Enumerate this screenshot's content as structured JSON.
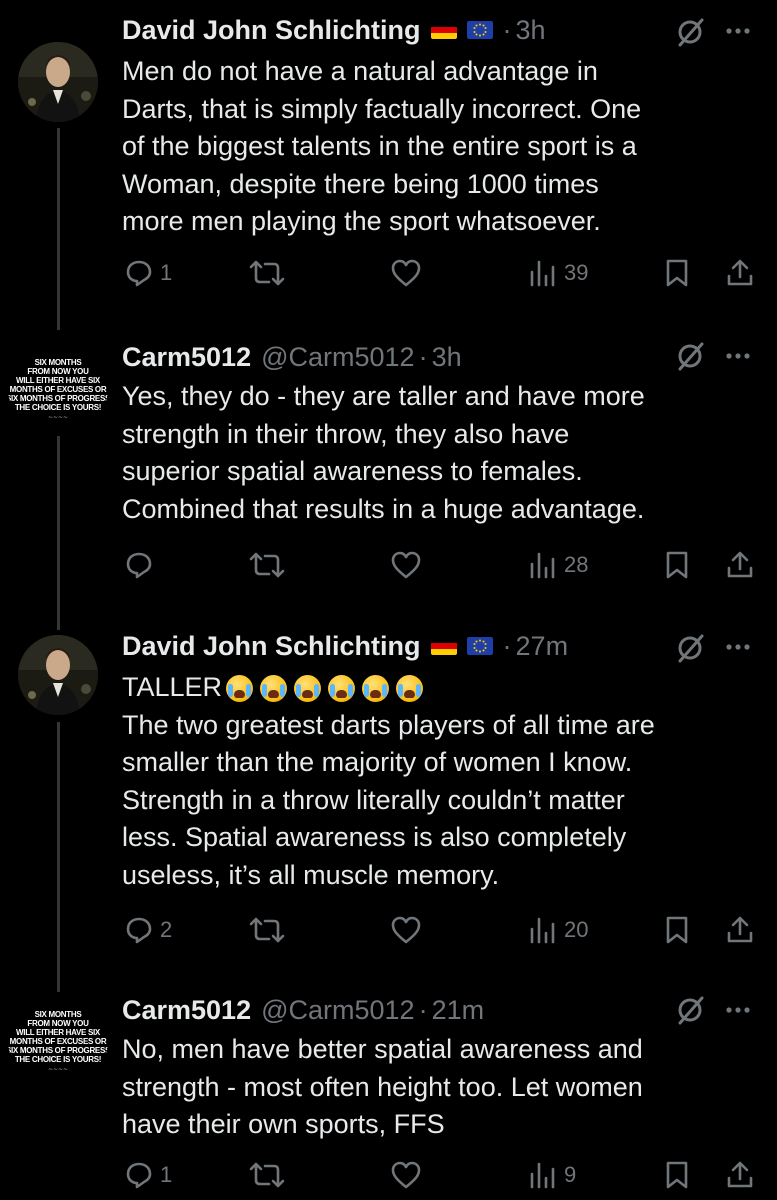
{
  "tweets": [
    {
      "author": "David John Schlichting",
      "flags": [
        "germany-flag",
        "eu-flag"
      ],
      "handle": "",
      "separator": "·",
      "time": "3h",
      "lines": [
        "Men do not have a natural advantage in",
        "Darts, that is simply factually incorrect. One",
        "of the biggest talents in the entire sport is a",
        "Woman, despite there being 1000 times",
        "more men playing the sport whatsoever."
      ],
      "replies": "1",
      "reposts": "",
      "likes": "",
      "views": "39"
    },
    {
      "author": "Carm5012",
      "flags": [],
      "handle": "@Carm5012",
      "separator": "·",
      "time": "3h",
      "lines": [
        "Yes, they do - they are taller and have more",
        "strength in their throw, they also have",
        "superior spatial awareness to females.",
        "Combined that results in a huge advantage."
      ],
      "replies": "",
      "reposts": "",
      "likes": "",
      "views": "28"
    },
    {
      "author": "David John Schlichting",
      "flags": [
        "germany-flag",
        "eu-flag"
      ],
      "handle": "",
      "separator": "·",
      "time": "27m",
      "first_line": "TALLER",
      "first_line_emoji": [
        "loudly-crying-face",
        "loudly-crying-face",
        "loudly-crying-face",
        "loudly-crying-face",
        "loudly-crying-face",
        "loudly-crying-face"
      ],
      "lines": [
        "The two greatest darts players of all time are",
        "smaller than the majority of women I know.",
        "Strength in a throw literally couldn’t matter",
        "less. Spatial awareness is also completely",
        "useless, it’s all muscle memory."
      ],
      "replies": "2",
      "reposts": "",
      "likes": "",
      "views": "20"
    },
    {
      "author": "Carm5012",
      "flags": [],
      "handle": "@Carm5012",
      "separator": "·",
      "time": "21m",
      "lines": [
        "No, men have better spatial awareness and",
        "strength - most often height too. Let women",
        "have their own sports, FFS"
      ],
      "replies": "1",
      "reposts": "",
      "likes": "",
      "views": "9"
    }
  ],
  "avatar_text": {
    "lines": [
      "SIX MONTHS",
      "FROM NOW YOU",
      "WILL EITHER HAVE SIX",
      "MONTHS OF EXCUSES OR",
      "SIX MONTHS OF PROGRESS",
      "THE CHOICE IS YOURS!"
    ]
  },
  "icons": {
    "reply": "reply-bubble-icon",
    "repost": "repost-arrows-icon",
    "like": "heart-icon",
    "views": "views-bars-icon",
    "bookmark": "bookmark-icon",
    "share": "share-upload-icon",
    "grok": "grok-slash-icon",
    "more": "more-dots-icon"
  },
  "colors": {
    "background": "#000000",
    "text": "#e7e9ea",
    "secondary": "#71767b"
  }
}
